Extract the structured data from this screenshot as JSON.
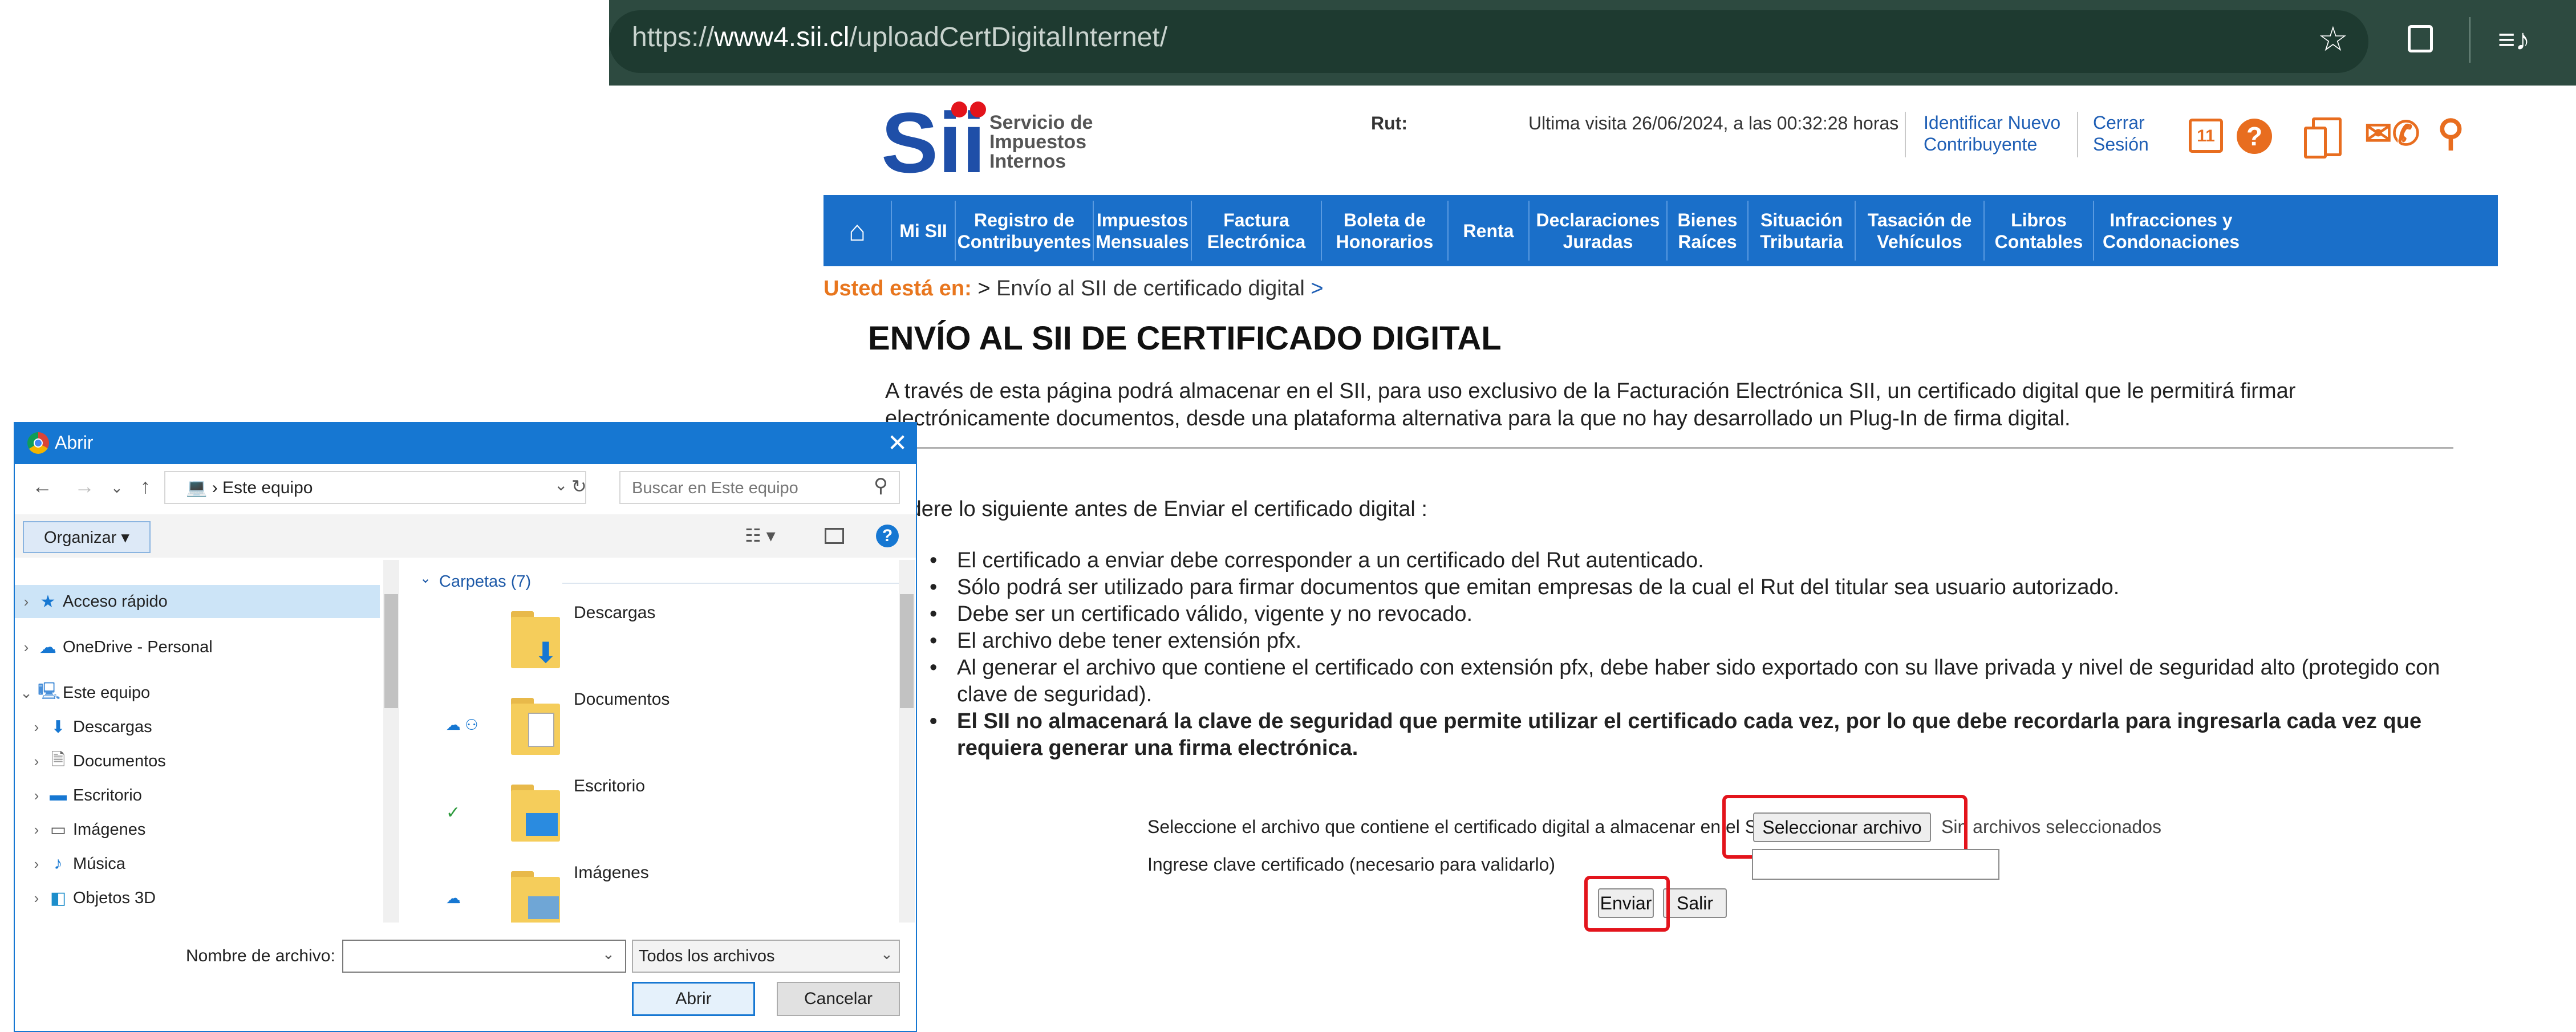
{
  "browser": {
    "url_prefix": "https://",
    "url_host": "www4.sii.cl",
    "url_path": "/uploadCertDigitalInternet/",
    "icons": [
      "star-icon",
      "extensions-icon",
      "media-icon"
    ]
  },
  "header": {
    "logo_text": "Sii",
    "org_line1": "Servicio de",
    "org_line2": "Impuestos",
    "org_line3": "Internos",
    "rut_label": "Rut:",
    "last_visit": "Ultima visita 26/06/2024, a las 00:32:28 horas",
    "identify_line1": "Identificar Nuevo",
    "identify_line2": "Contribuyente",
    "logout_line1": "Cerrar",
    "logout_line2": "Sesión",
    "calendar_day": "11",
    "help_glyph": "?",
    "icons": [
      "calendar-icon",
      "help-icon",
      "documents-icon",
      "contact-icon",
      "search-icon"
    ],
    "accent_color": "#e86d1f"
  },
  "nav": {
    "home_icon": "home-icon",
    "items": [
      {
        "line1": "Mi SII",
        "line2": ""
      },
      {
        "line1": "Registro de",
        "line2": "Contribuyentes"
      },
      {
        "line1": "Impuestos",
        "line2": "Mensuales"
      },
      {
        "line1": "Factura",
        "line2": "Electrónica"
      },
      {
        "line1": "Boleta de",
        "line2": "Honorarios"
      },
      {
        "line1": "Renta",
        "line2": ""
      },
      {
        "line1": "Declaraciones",
        "line2": "Juradas"
      },
      {
        "line1": "Bienes",
        "line2": "Raíces"
      },
      {
        "line1": "Situación",
        "line2": "Tributaria"
      },
      {
        "line1": "Tasación de",
        "line2": "Vehículos"
      },
      {
        "line1": "Libros",
        "line2": "Contables"
      },
      {
        "line1": "Infracciones y",
        "line2": "Condonaciones"
      }
    ],
    "bar_color": "#1a6fc9"
  },
  "breadcrumb": {
    "label": "Usted está en:",
    "separator": ">",
    "current": "Envío al SII de certificado digital",
    "trailing": ">"
  },
  "page": {
    "title": "ENVÍO AL SII DE CERTIFICADO DIGITAL",
    "intro": "A través de esta página podrá almacenar en el SII, para uso exclusivo de la Facturación Electrónica SII, un certificado digital que le permitirá firmar electrónicamente documentos, desde una plataforma alternativa para la que no hay desarrollado un Plug-In de firma digital.",
    "consider": "nsidere lo siguiente antes de Enviar el certificado digital :",
    "points": [
      "El certificado a enviar debe corresponder a un certificado del Rut autenticado.",
      "Sólo podrá ser utilizado para firmar documentos que emitan empresas de la cual el Rut del titular sea usuario autorizado.",
      "Debe ser un certificado válido, vigente y no revocado.",
      "El archivo debe tener extensión pfx.",
      "Al generar el archivo que contiene el certificado con extensión pfx, debe haber sido exportado con su llave privada y nivel de seguridad alto (protegido con clave de seguridad).",
      "El SII no almacenará la clave de seguridad que permite utilizar el certificado cada vez, por lo que debe recordarla para ingresarla cada vez que requiera generar una firma electrónica."
    ]
  },
  "form": {
    "file_label": "Seleccione el archivo que contiene el certificado digital a almacenar en el SII",
    "select_button": "Seleccionar archivo",
    "no_file": "Sin archivos seleccionados",
    "password_label": "Ingrese clave certificado (necesario para validarlo)",
    "password_value": "",
    "submit_button": "Enviar",
    "exit_button": "Salir",
    "highlight_color": "#e3141c"
  },
  "dialog": {
    "title": "Abrir",
    "path_label": "Este equipo",
    "search_placeholder": "Buscar en Este equipo",
    "organize_label": "Organizar ▾",
    "tree": [
      {
        "label": "Acceso rápido",
        "icon": "star-icon",
        "selected": true
      },
      {
        "label": "OneDrive - Personal",
        "icon": "cloud-icon"
      },
      {
        "label": "Este equipo",
        "icon": "computer-icon",
        "expanded": true
      },
      {
        "label": "Descargas",
        "icon": "download-icon"
      },
      {
        "label": "Documentos",
        "icon": "document-icon"
      },
      {
        "label": "Escritorio",
        "icon": "desktop-icon"
      },
      {
        "label": "Imágenes",
        "icon": "image-icon"
      },
      {
        "label": "Música",
        "icon": "music-icon"
      },
      {
        "label": "Objetos 3D",
        "icon": "cube-icon"
      }
    ],
    "group_header": "Carpetas (7)",
    "folders": [
      {
        "label": "Descargas",
        "status": "",
        "badge": "download-icon"
      },
      {
        "label": "Documentos",
        "status": "cloud-icon",
        "badge": "document-icon"
      },
      {
        "label": "Escritorio",
        "status": "check-icon",
        "badge": "desktop-icon"
      },
      {
        "label": "Imágenes",
        "status": "cloud-icon",
        "badge": "image-icon"
      }
    ],
    "filename_label": "Nombre de archivo:",
    "filename_value": "",
    "filter_value": "Todos los archivos",
    "open_button": "Abrir",
    "cancel_button": "Cancelar"
  }
}
